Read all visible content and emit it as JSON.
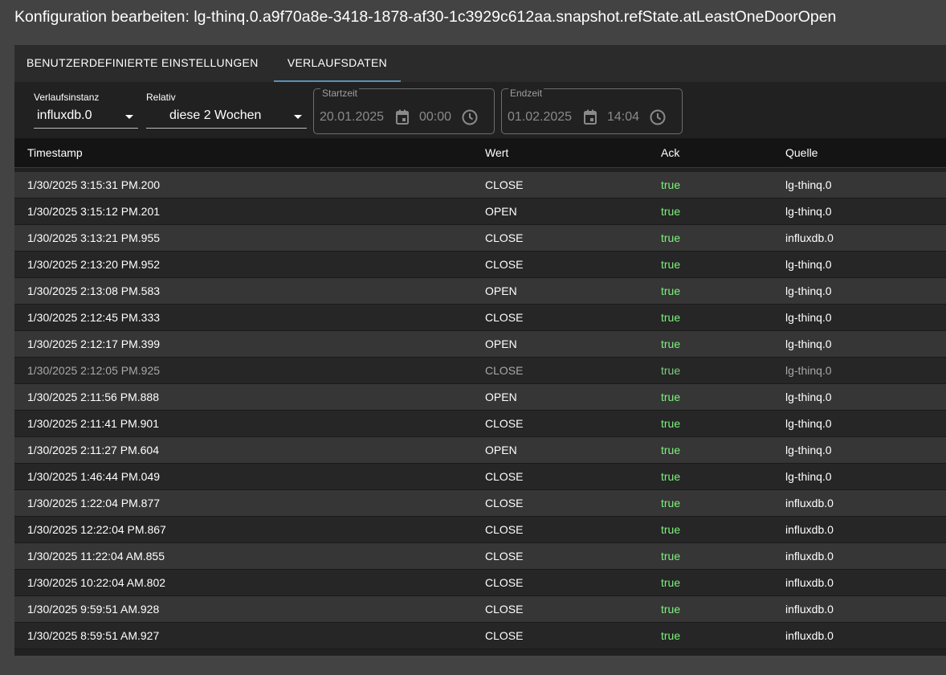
{
  "title": "Konfiguration bearbeiten: lg-thinq.0.a9f70a8e-3418-1878-af30-1c3929c612aa.snapshot.refState.atLeastOneDoorOpen",
  "tabs": [
    {
      "label": "BENUTZERDEFINIERTE EINSTELLUNGEN",
      "active": false
    },
    {
      "label": "VERLAUFSDATEN",
      "active": true
    }
  ],
  "filters": {
    "instance": {
      "label": "Verlaufsinstanz",
      "value": "influxdb.0"
    },
    "relative": {
      "label": "Relativ",
      "value": "diese 2 Wochen"
    },
    "start": {
      "label": "Startzeit",
      "date": "20.01.2025",
      "time": "00:00"
    },
    "end": {
      "label": "Endzeit",
      "date": "01.02.2025",
      "time": "14:04"
    }
  },
  "table": {
    "columns": [
      "Timestamp",
      "Wert",
      "Ack",
      "Quelle"
    ],
    "rows": [
      {
        "timestamp": "1/30/2025 3:15:31 PM.200",
        "value": "CLOSE",
        "ack": "true",
        "source": "lg-thinq.0"
      },
      {
        "timestamp": "1/30/2025 3:15:12 PM.201",
        "value": "OPEN",
        "ack": "true",
        "source": "lg-thinq.0"
      },
      {
        "timestamp": "1/30/2025 3:13:21 PM.955",
        "value": "CLOSE",
        "ack": "true",
        "source": "influxdb.0"
      },
      {
        "timestamp": "1/30/2025 2:13:20 PM.952",
        "value": "CLOSE",
        "ack": "true",
        "source": "lg-thinq.0"
      },
      {
        "timestamp": "1/30/2025 2:13:08 PM.583",
        "value": "OPEN",
        "ack": "true",
        "source": "lg-thinq.0"
      },
      {
        "timestamp": "1/30/2025 2:12:45 PM.333",
        "value": "CLOSE",
        "ack": "true",
        "source": "lg-thinq.0"
      },
      {
        "timestamp": "1/30/2025 2:12:17 PM.399",
        "value": "OPEN",
        "ack": "true",
        "source": "lg-thinq.0"
      },
      {
        "timestamp": "1/30/2025 2:12:05 PM.925",
        "value": "CLOSE",
        "ack": "true",
        "source": "lg-thinq.0"
      },
      {
        "timestamp": "1/30/2025 2:11:56 PM.888",
        "value": "OPEN",
        "ack": "true",
        "source": "lg-thinq.0"
      },
      {
        "timestamp": "1/30/2025 2:11:41 PM.901",
        "value": "CLOSE",
        "ack": "true",
        "source": "lg-thinq.0"
      },
      {
        "timestamp": "1/30/2025 2:11:27 PM.604",
        "value": "OPEN",
        "ack": "true",
        "source": "lg-thinq.0"
      },
      {
        "timestamp": "1/30/2025 1:46:44 PM.049",
        "value": "CLOSE",
        "ack": "true",
        "source": "lg-thinq.0"
      },
      {
        "timestamp": "1/30/2025 1:22:04 PM.877",
        "value": "CLOSE",
        "ack": "true",
        "source": "influxdb.0"
      },
      {
        "timestamp": "1/30/2025 12:22:04 PM.867",
        "value": "CLOSE",
        "ack": "true",
        "source": "influxdb.0"
      },
      {
        "timestamp": "1/30/2025 11:22:04 AM.855",
        "value": "CLOSE",
        "ack": "true",
        "source": "influxdb.0"
      },
      {
        "timestamp": "1/30/2025 10:22:04 AM.802",
        "value": "CLOSE",
        "ack": "true",
        "source": "influxdb.0"
      },
      {
        "timestamp": "1/30/2025 9:59:51 AM.928",
        "value": "CLOSE",
        "ack": "true",
        "source": "influxdb.0"
      },
      {
        "timestamp": "1/30/2025 8:59:51 AM.927",
        "value": "CLOSE",
        "ack": "true",
        "source": "influxdb.0"
      }
    ]
  },
  "colors": {
    "accent": "#5b8fb9",
    "ack_true": "#7df27d"
  }
}
